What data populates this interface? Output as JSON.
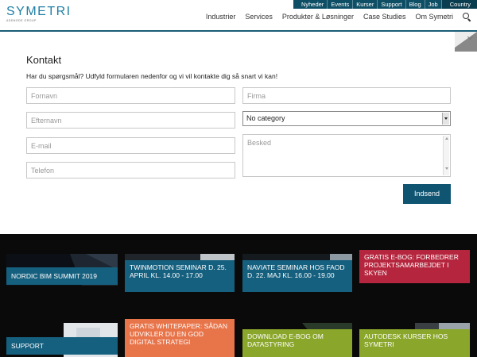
{
  "topbar": {
    "links": [
      "Nyheder",
      "Events",
      "Kurser",
      "Support",
      "Blog",
      "Job"
    ],
    "country": "Country"
  },
  "logo": {
    "name": "SYMETRI",
    "sub": "ADDNODE GROUP"
  },
  "nav": {
    "items": [
      "Industrier",
      "Services",
      "Produkter & Løsninger",
      "Case Studies",
      "Om Symetri"
    ],
    "search_icon": "search-icon"
  },
  "contact": {
    "title": "Kontakt",
    "intro": "Har du spørgsmål? Udfyld formularen nedenfor og vi vil kontakte dig så snart vi kan!",
    "fields": {
      "firstname": {
        "placeholder": "Fornavn",
        "value": ""
      },
      "lastname": {
        "placeholder": "Efternavn",
        "value": ""
      },
      "email": {
        "placeholder": "E-mail",
        "value": ""
      },
      "phone": {
        "placeholder": "Telefon",
        "value": ""
      },
      "company": {
        "placeholder": "Firma",
        "value": ""
      },
      "message": {
        "placeholder": "Besked",
        "value": ""
      }
    },
    "category_selected": "No category",
    "submit_label": "Indsend"
  },
  "tiles": [
    {
      "label": "NORDIC BIM SUMMIT 2019",
      "color": "#16607f"
    },
    {
      "label": "TWINMOTION SEMINAR D. 25. APRIL KL. 14.00 - 17.00",
      "color": "#16607f"
    },
    {
      "label": "NAVIATE SEMINAR HOS FAOD D. 22. MAJ KL. 16.00 - 19.00",
      "color": "#16607f"
    },
    {
      "label": "GRATIS E-BOG: FORBEDRER PROJEKTSAMARBEJDET I SKYEN",
      "color": "#b5263e"
    },
    {
      "label": "SUPPORT",
      "color": "#16607f"
    },
    {
      "label": "GRATIS WHITEPAPER: SÅDAN UDVIKLER DU EN GOD DIGITAL STRATEGI",
      "color": "#e8744a"
    },
    {
      "label": "DOWNLOAD E-BOG OM DATASTYRING",
      "color": "#8aa62b"
    },
    {
      "label": "AUTODESK KURSER HOS SYMETRI",
      "color": "#8aa62b"
    }
  ]
}
